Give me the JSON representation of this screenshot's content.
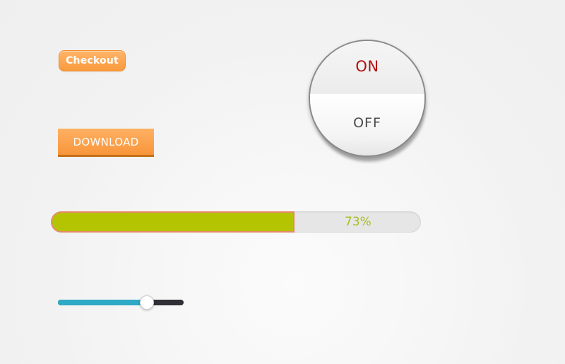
{
  "buttons": {
    "checkout_label": "Checkout",
    "download_label": "DOWNLOAD"
  },
  "toggle": {
    "on_label": "ON",
    "off_label": "OFF",
    "state": "on"
  },
  "progress": {
    "value": 0.73,
    "label": "73%"
  },
  "slider": {
    "value": 0.71
  },
  "colors": {
    "accent_orange": "#fa9b3e",
    "progress_fill": "#b5c400",
    "progress_text": "#a9be1e",
    "slider_fill": "#2ea9c6",
    "toggle_on_text": "#b30d0d"
  }
}
